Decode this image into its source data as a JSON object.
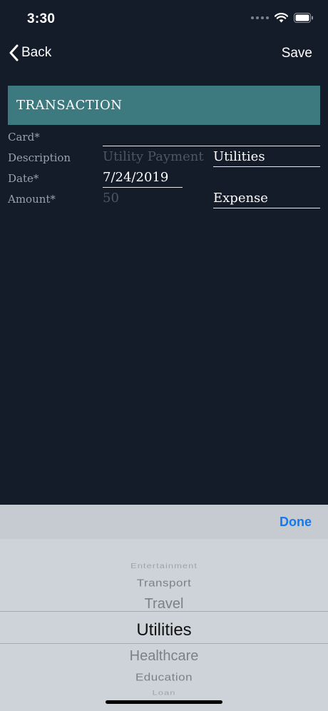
{
  "status_bar": {
    "time": "3:30"
  },
  "nav": {
    "back_label": "Back",
    "save_label": "Save"
  },
  "section": {
    "title": "TRANSACTION"
  },
  "form": {
    "card_label": "Card*",
    "card_value": "",
    "description_label": "Description",
    "description_placeholder": "Utility Payment",
    "category_value": "Utilities",
    "date_label": "Date*",
    "date_value": "7/24/2019",
    "amount_label": "Amount*",
    "amount_placeholder": "50",
    "type_value": "Expense"
  },
  "picker": {
    "done_label": "Done",
    "items": [
      "Entertainment",
      "Transport",
      "Travel",
      "Utilities",
      "Healthcare",
      "Education",
      "Loan"
    ],
    "selected": "Utilities"
  },
  "colors": {
    "background": "#141c2a",
    "header": "#3d7a80",
    "accent": "#1478f0"
  }
}
